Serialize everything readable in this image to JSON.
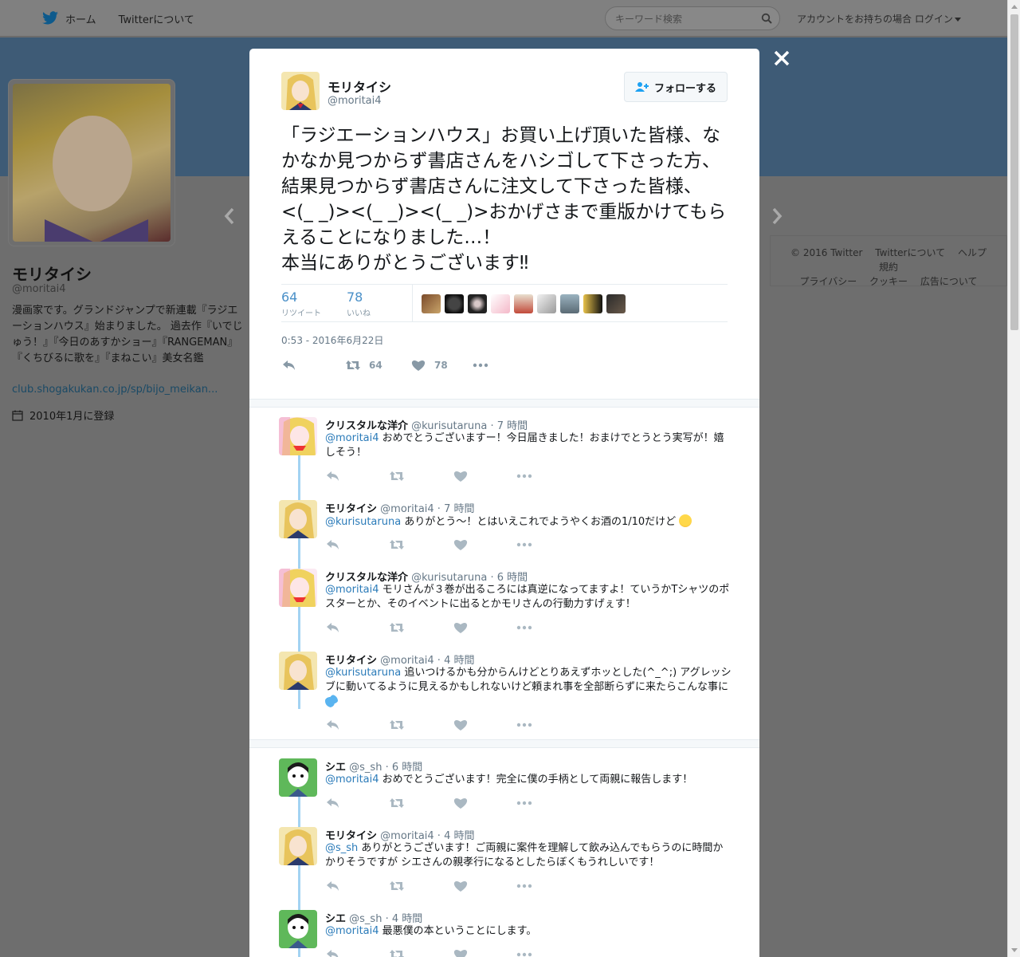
{
  "topnav": {
    "home_label": "ホーム",
    "about_label": "Twitterについて",
    "search_placeholder": "キーワード検索",
    "login_label": "アカウントをお持ちの場合 ログイン"
  },
  "profile": {
    "name": "モリタイシ",
    "handle": "@moritai4",
    "bio": "漫画家です。グランドジャンプで新連載『ラジエーションハウス』始まりました。 過去作『いでじゅう！』『今日のあすかショー』『RANGEMAN』『くちびるに歌を』『まねこい』美女名鑑",
    "link": "club.shogakukan.co.jp/sp/bijo_meikan...",
    "joined": "2010年1月に登録"
  },
  "footer": {
    "items": [
      "© 2016 Twitter",
      "Twitterについて",
      "ヘルプ",
      "規約",
      "プライバシー",
      "クッキー",
      "広告について"
    ]
  },
  "tweet": {
    "author_name": "モリタイシ",
    "author_handle": "@moritai4",
    "follow_label": "フォローする",
    "text": "「ラジエーションハウス」お買い上げ頂いた皆様、なかなか見つからず書店さんをハシゴして下さった方、結果見つからず書店さんに注文して下さった皆様、<(_ _)><(_ _)><(_ _)>おかげさまで重版かけてもらえることになりました…！\n本当にありがとうございます‼︎",
    "retweets": "64",
    "retweets_label": "リツイート",
    "likes": "78",
    "likes_label": "いいね",
    "timestamp": "0:53 - 2016年6月22日",
    "action_retweets": "64",
    "action_likes": "78"
  },
  "replies": [
    {
      "name": "クリスタルな洋介",
      "meta": "@kurisutaruna · 7 時間",
      "mention": "@moritai4",
      "text": " おめでとうございますー！今日届きました！おまけでとうとう実写が！嬉しそう！"
    },
    {
      "name": "モリタイシ",
      "meta": "@moritai4 · 7 時間",
      "mention": "@kurisutaruna",
      "text": " ありがとう〜！とはいえこれでようやくお酒の1/10だけど"
    },
    {
      "name": "クリスタルな洋介",
      "meta": "@kurisutaruna · 6 時間",
      "mention": "@moritai4",
      "text": " モリさんが３巻が出るころには真逆になってますよ！ていうかTシャツのポスターとか、そのイベントに出るとかモリさんの行動力すげぇす！"
    },
    {
      "name": "モリタイシ",
      "meta": "@moritai4 · 4 時間",
      "mention": "@kurisutaruna",
      "text": " 追いつけるかも分からんけどとりあえずホッとした(^_^;) アグレッシブに動いてるように見えるかもしれないけど頼まれ事を全部断らずに来たらこんな事に"
    },
    {
      "name": "シエ",
      "meta": "@s_sh · 6 時間",
      "mention": "@moritai4",
      "text": " おめでとうございます！完全に僕の手柄として両親に報告します！"
    },
    {
      "name": "モリタイシ",
      "meta": "@moritai4 · 4 時間",
      "mention": "@s_sh",
      "text": " ありがとうございます！ご両親に案件を理解して飲み込んでもらうのに時間かかりそうですが シエさんの親孝行になるとしたらぼくもうれしいです！"
    },
    {
      "name": "シエ",
      "meta": "@s_sh · 4 時間",
      "mention": "@moritai4",
      "text": " 最悪僕の本ということにします。"
    }
  ],
  "colors": {
    "accent": "#1da1f2",
    "link": "#2b7bb9",
    "thread_line": "#a3d3f2"
  }
}
